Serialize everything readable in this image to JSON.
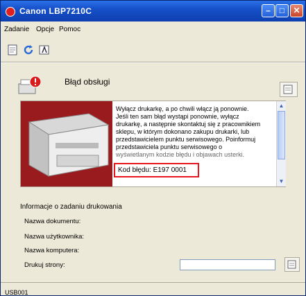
{
  "window": {
    "title": "Canon LBP7210C",
    "title_color": "#1650c8"
  },
  "menu": [
    "Zadanie",
    "Opcje",
    "Pomoc"
  ],
  "toolbar": {
    "icons": [
      "document-icon",
      "refresh-icon",
      "printer-properties-icon"
    ]
  },
  "status": {
    "text": "Błąd obsługi",
    "icon": "error-printer-icon"
  },
  "message": {
    "lines": [
      "Wyłącz drukarkę, a po chwili włącz ją ponownie.",
      "Jeśli ten sam błąd wystąpi ponownie, wyłącz",
      "drukarkę, a następnie skontaktuj się z pracownikiem",
      "sklepu, w którym dokonano zakupu drukarki, lub",
      "przedstawicielem punktu serwisowego. Poinformuj",
      "przedstawiciela punktu serwisowego o",
      "wyświetlanym kodzie błędu i objawach usterki."
    ],
    "error_code": "Kod błędu: E197 0001",
    "highlight_color": "#e8161c"
  },
  "job_info": {
    "title": "Informacje o zadaniu drukowania",
    "document_name_label": "Nazwa dokumentu:",
    "user_name_label": "Nazwa użytkownika:",
    "computer_name_label": "Nazwa komputera:",
    "printed_pages_label": "Drukuj strony:"
  },
  "statusbar": {
    "text": "USB001"
  }
}
